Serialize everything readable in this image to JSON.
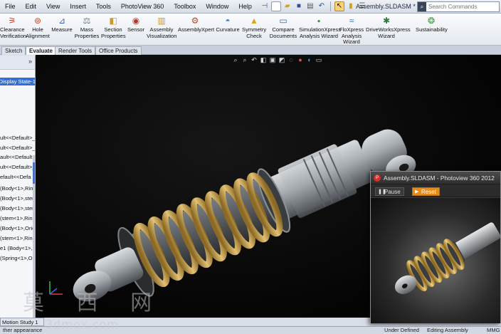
{
  "menubar": {
    "items": [
      "File",
      "Edit",
      "View",
      "Insert",
      "Tools",
      "PhotoView 360",
      "Toolbox",
      "Window",
      "Help"
    ],
    "doc_title": "Assembly.SLDASM *",
    "search_placeholder": "Search Commands"
  },
  "ribbon": {
    "tools": [
      {
        "label": "Clearance\nVerification",
        "icon": "clearance-icon"
      },
      {
        "label": "Hole\nAlignment",
        "icon": "hole-alignment-icon"
      },
      {
        "label": "Measure",
        "icon": "measure-icon"
      },
      {
        "label": "Mass\nProperties",
        "icon": "mass-properties-icon"
      },
      {
        "label": "Section\nProperties",
        "icon": "section-properties-icon"
      },
      {
        "label": "Sensor",
        "icon": "sensor-icon"
      },
      {
        "label": "Assembly\nVisualization",
        "icon": "assembly-visualization-icon"
      },
      {
        "label": "AssemblyXpert",
        "icon": "assemblyxpert-icon"
      },
      {
        "label": "Curvature",
        "icon": "curvature-icon"
      },
      {
        "label": "Symmetry\nCheck",
        "icon": "symmetry-check-icon"
      },
      {
        "label": "Compare\nDocuments",
        "icon": "compare-documents-icon"
      },
      {
        "label": "SimulationXpress\nAnalysis Wizard",
        "icon": "simulationxpress-icon"
      },
      {
        "label": "FloXpress\nAnalysis\nWizard",
        "icon": "floxpress-icon"
      },
      {
        "label": "DriveWorksXpress\nWizard",
        "icon": "driveworksxpress-icon"
      },
      {
        "label": "Sustainability",
        "icon": "sustainability-icon"
      }
    ]
  },
  "tabs": [
    {
      "label": "Sketch",
      "active": false
    },
    {
      "label": "Evaluate",
      "active": true
    },
    {
      "label": "Render Tools",
      "active": false
    },
    {
      "label": "Office Products",
      "active": false
    }
  ],
  "feature_tree": {
    "display_state": "Display State-1>",
    "items": [
      "ult<<Default>_",
      "ult<<Default>_",
      "ault<<Default",
      "ult<<Default>_",
      "efault<<Defa",
      "(Body<1>,Rin",
      "(Body<1>,ster",
      "(Body<1>,ster",
      "(stem<1>,Ring",
      "(Body<1>,Orie",
      "(stem<1>,Ring",
      "e1 (Body<1>,s",
      "(Spring<1>,O"
    ]
  },
  "bottom": {
    "motion_study": "Motion Study 1",
    "status_hint": "ther appearance",
    "status_defined": "Under Defined",
    "status_mode": "Editing Assembly",
    "status_units": "MMG"
  },
  "photoview": {
    "title": "Assembly.SLDASM - Photoview 360 2012",
    "pause_label": "Pause",
    "reset_label": "Reset"
  },
  "watermark": {
    "chars": "莫 西 网",
    "url": "3dmox.com"
  },
  "colors": {
    "spring": "#c9a24a",
    "metal": "#8c9196",
    "viewport_bg": "#050505",
    "selection": "#2f6fd6",
    "reset_button": "#e58a1d"
  }
}
